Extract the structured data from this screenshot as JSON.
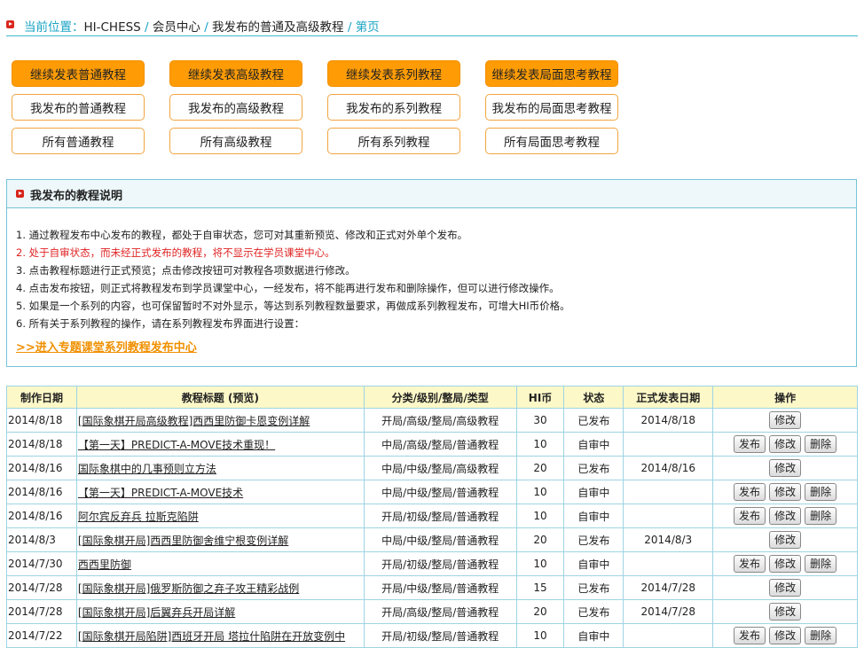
{
  "breadcrumb": {
    "prefix": "当前位置：",
    "items": [
      "HI-CHESS",
      "会员中心",
      "我发布的普通及高级教程",
      "第页"
    ],
    "sep": " / "
  },
  "buttons": [
    [
      "继续发表普通教程",
      "继续发表高级教程",
      "继续发表系列教程",
      "继续发表局面思考教程"
    ],
    [
      "我发布的普通教程",
      "我发布的高级教程",
      "我发布的系列教程",
      "我发布的局面思考教程"
    ],
    [
      "所有普通教程",
      "所有高级教程",
      "所有系列教程",
      "所有局面思考教程"
    ]
  ],
  "panel": {
    "title": "我发布的教程说明",
    "notes": [
      "1. 通过教程发布中心发布的教程，都处于自审状态，您可对其重新预览、修改和正式对外单个发布。",
      "2. 处于自审状态，而未经正式发布的教程，将不显示在学员课堂中心。",
      "3. 点击教程标题进行正式预览；点击修改按钮可对教程各项数据进行修改。",
      "4. 点击发布按钮，则正式将教程发布到学员课堂中心，一经发布，将不能再进行发布和删除操作，但可以进行修改操作。",
      "5. 如果是一个系列的内容，也可保留暂时不对外显示，等达到系列教程数量要求，再做成系列教程发布，可增大HI币价格。",
      "6. 所有关于系列教程的操作，请在系列教程发布界面进行设置："
    ],
    "link": ">>进入专题课堂系列教程发布中心"
  },
  "table": {
    "headers": [
      "制作日期",
      "教程标题 (预览)",
      "分类/级别/整局/类型",
      "HI币",
      "状态",
      "正式发表日期",
      "操作"
    ],
    "ops": {
      "publish": "发布",
      "edit": "修改",
      "delete": "删除"
    },
    "rows": [
      {
        "date": "2014/8/18",
        "title": "[国际象棋开局高级教程]西西里防御卡恩变例详解",
        "cat": "开局/高级/整局/高级教程",
        "hi": "30",
        "status": "已发布",
        "pub": "2014/8/18",
        "ops": [
          "edit"
        ]
      },
      {
        "date": "2014/8/18",
        "title": "【第一天】PREDICT-A-MOVE技术重现！",
        "cat": "中局/高级/整局/普通教程",
        "hi": "10",
        "status": "自审中",
        "pub": "",
        "ops": [
          "publish",
          "edit",
          "delete"
        ]
      },
      {
        "date": "2014/8/16",
        "title": "国际象棋中的几事预则立方法",
        "cat": "中局/中级/整局/高级教程",
        "hi": "20",
        "status": "已发布",
        "pub": "2014/8/16",
        "ops": [
          "edit"
        ]
      },
      {
        "date": "2014/8/16",
        "title": "【第一天】PREDICT-A-MOVE技术",
        "cat": "中局/中级/整局/普通教程",
        "hi": "10",
        "status": "自审中",
        "pub": "",
        "ops": [
          "publish",
          "edit",
          "delete"
        ]
      },
      {
        "date": "2014/8/16",
        "title": "阿尔宾反弃兵 拉斯克陷阱",
        "cat": "开局/初级/整局/普通教程",
        "hi": "10",
        "status": "自审中",
        "pub": "",
        "ops": [
          "publish",
          "edit",
          "delete"
        ]
      },
      {
        "date": "2014/8/3",
        "title": "[国际象棋开局]西西里防御舍维宁根变例详解",
        "cat": "中局/中级/整局/普通教程",
        "hi": "20",
        "status": "已发布",
        "pub": "2014/8/3",
        "ops": [
          "edit"
        ]
      },
      {
        "date": "2014/7/30",
        "title": "西西里防御",
        "cat": "开局/初级/整局/普通教程",
        "hi": "10",
        "status": "自审中",
        "pub": "",
        "ops": [
          "publish",
          "edit",
          "delete"
        ]
      },
      {
        "date": "2014/7/28",
        "title": "[国际象棋开局]俄罗斯防御之弃子攻王精彩战例",
        "cat": "开局/中级/整局/普通教程",
        "hi": "15",
        "status": "已发布",
        "pub": "2014/7/28",
        "ops": [
          "edit"
        ]
      },
      {
        "date": "2014/7/28",
        "title": "[国际象棋开局]后翼弃兵开局详解",
        "cat": "开局/高级/整局/普通教程",
        "hi": "20",
        "status": "已发布",
        "pub": "2014/7/28",
        "ops": [
          "edit"
        ]
      },
      {
        "date": "2014/7/22",
        "title": "[国际象棋开局陷阱]西班牙开局 塔拉什陷阱在开放变例中",
        "cat": "开局/初级/整局/普通教程",
        "hi": "10",
        "status": "自审中",
        "pub": "",
        "ops": [
          "publish",
          "edit",
          "delete"
        ]
      }
    ]
  },
  "colors": {
    "accent": "#1aa3c4",
    "orange": "#ff9c05",
    "red": "#e02424",
    "link": "#f09000",
    "header_bg": "#fdf8c8"
  }
}
